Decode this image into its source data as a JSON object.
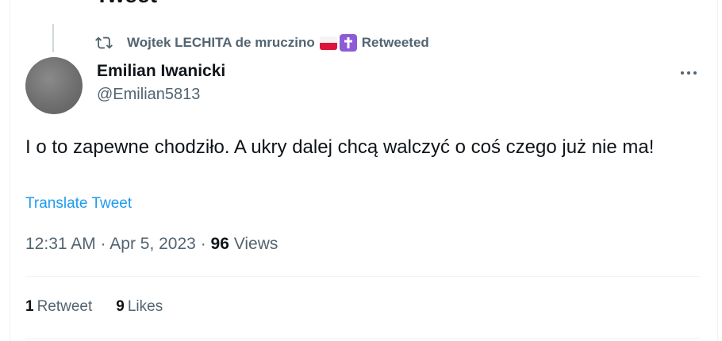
{
  "previous_tweet": {
    "heading_fragment": "Tweet"
  },
  "retweet_context": {
    "user": "Wojtek LECHITA de mruczino",
    "emojis": [
      "flag-poland",
      "latin-cross-purple"
    ],
    "action": "Retweeted"
  },
  "author": {
    "display_name": "Emilian Iwanicki",
    "handle": "@Emilian5813"
  },
  "tweet": {
    "text": "I o to zapewne chodziło. A ukry dalej chcą walczyć o coś czego już nie ma!",
    "translate_label": "Translate Tweet",
    "time": "12:31 AM",
    "date": "Apr 5, 2023",
    "separator": "·",
    "views_count": "96",
    "views_label": "Views"
  },
  "stats": {
    "retweets_count": "1",
    "retweets_label": "Retweet",
    "likes_count": "9",
    "likes_label": "Likes"
  },
  "colors": {
    "text_primary": "#0f1419",
    "text_secondary": "#536471",
    "link": "#1d9bf0",
    "divider": "#eff3f4"
  }
}
